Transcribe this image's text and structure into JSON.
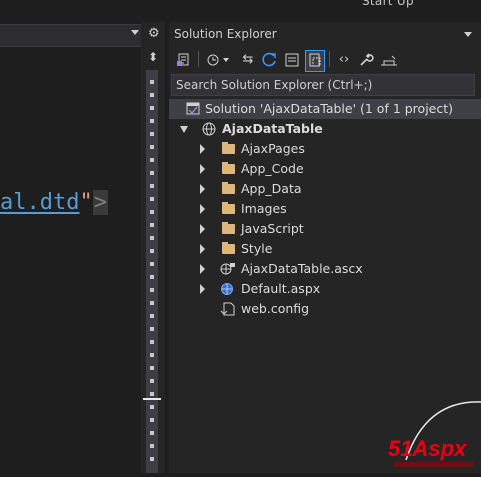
{
  "window": {
    "top_title": "Start Up"
  },
  "editor": {
    "code_link_text": "al.dtd",
    "code_quote": "\"",
    "code_bracket": ">"
  },
  "solution_explorer": {
    "title": "Solution Explorer",
    "search_placeholder": "Search Solution Explorer (Ctrl+;)",
    "tree": {
      "solution": "Solution 'AjaxDataTable' (1 of 1 project)",
      "project": "AjaxDataTable",
      "items": [
        {
          "label": "AjaxPages",
          "type": "folder",
          "expandable": true
        },
        {
          "label": "App_Code",
          "type": "folder",
          "expandable": true
        },
        {
          "label": "App_Data",
          "type": "folder",
          "expandable": true
        },
        {
          "label": "Images",
          "type": "folder",
          "expandable": true
        },
        {
          "label": "JavaScript",
          "type": "folder",
          "expandable": true
        },
        {
          "label": "Style",
          "type": "folder",
          "expandable": true
        },
        {
          "label": "AjaxDataTable.ascx",
          "type": "ascx",
          "expandable": true
        },
        {
          "label": "Default.aspx",
          "type": "aspx",
          "expandable": true
        },
        {
          "label": "web.config",
          "type": "config",
          "expandable": false
        }
      ]
    }
  },
  "watermark": {
    "text": "51Aspx"
  },
  "colors": {
    "background": "#1e1e1e",
    "panel": "#252526",
    "accent": "#3399ff",
    "folder": "#dcb67a",
    "link": "#569cd6",
    "watermark_red": "#e60012"
  }
}
